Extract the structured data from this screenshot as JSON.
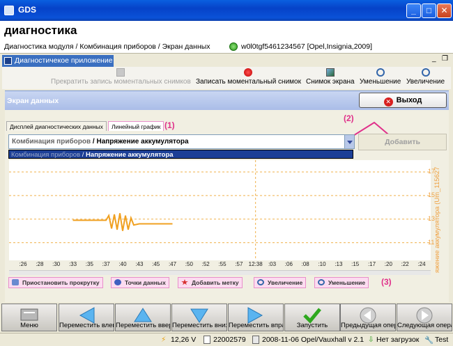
{
  "window": {
    "title": "GDS"
  },
  "header": {
    "title": "диагностика",
    "breadcrumb": "Диагностика модуля / Комбинация приборов / Экран данных",
    "vehicle": "w0l0tgf5461234567 [Opel,Insignia,2009]"
  },
  "app_tab": {
    "label": "Диагностичекое приложение"
  },
  "toolbar": {
    "stop_snapshot": "Прекратить запись моментальных снимков",
    "record_snapshot": "Записать моментальный снимок",
    "screenshot": "Снимок экрана",
    "zoom_out": "Уменьшение",
    "zoom_in": "Увеличение"
  },
  "panel": {
    "title": "Экран данных",
    "exit_label": "Выход"
  },
  "tabs": [
    {
      "label": "Дисплей диагностических данных"
    },
    {
      "label": "Линейный график"
    }
  ],
  "annotations": {
    "a1": "(1)",
    "a2": "(2)",
    "a3": "(3)"
  },
  "signal": {
    "group": "Комбинация приборов",
    "sep": " / ",
    "name": "Напряжение аккумулятора",
    "add_label": "Добавить"
  },
  "chart_data": {
    "type": "line",
    "ylabel": "яжение аккумулятора (Um_115627",
    "yticks": [
      11,
      13,
      15,
      17
    ],
    "ylim": [
      9.5,
      18
    ],
    "xticks": [
      ":26",
      ":28",
      ":30",
      ":33",
      ":35",
      ":37",
      ":40",
      ":43",
      ":45",
      ":47",
      ":50",
      ":52",
      ":55",
      ":57",
      "12:38",
      ":03",
      ":06",
      ":08",
      ":10",
      ":13",
      ":15",
      ":17",
      ":20",
      ":22",
      ":24"
    ],
    "series": [
      {
        "values": [
          [
            ":33",
            12.9
          ],
          [
            ":37",
            12.9
          ],
          [
            ":37.5",
            13.3
          ],
          [
            ":38",
            12.2
          ],
          [
            ":38.5",
            13.4
          ],
          [
            ":39",
            12.1
          ],
          [
            ":39.5",
            13.5
          ],
          [
            ":40",
            12.0
          ],
          [
            ":40.5",
            13.3
          ],
          [
            ":41",
            12.1
          ],
          [
            ":41.5",
            13.1
          ],
          [
            ":42",
            12.5
          ],
          [
            ":43",
            12.6
          ],
          [
            ":47",
            12.6
          ]
        ],
        "color": "#f0a020"
      }
    ]
  },
  "plot_buttons": {
    "pause": "Приостановить прокрутку",
    "points": "Точки данных",
    "mark": "Добавить метку",
    "zoom_in": "Увеличение",
    "zoom_out": "Уменьшение"
  },
  "nav": {
    "menu": "Меню",
    "left": "Переместить влево",
    "up": "Переместить вверх",
    "down": "Переместить вниз",
    "right": "Переместить вправо",
    "start": "Запустить",
    "prev": "Предыдущая операция",
    "next": "Следующая операция"
  },
  "status": {
    "voltage": "12,26 V",
    "id": "22002579",
    "version": "2008-11-06 Opel/Vauxhall v 2.1",
    "downloads": "Нет загрузок",
    "mode": "Test"
  },
  "colors": {
    "accent": "#0a52d8",
    "pink": "#e0308a",
    "orange": "#f0a020"
  }
}
